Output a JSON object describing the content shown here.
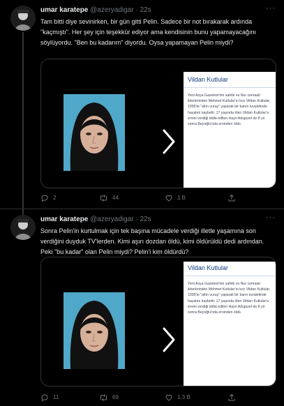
{
  "tweets": [
    {
      "user": {
        "name": "umar karatepe",
        "handle": "@azeryadigar",
        "dot": "·",
        "time": "22s"
      },
      "text": "Tam bitti diye sevinirken, bir gün gitti Pelin. Sadece bir not bırakarak ardında \"kaçmıştı\". Her şey için teşekkür ediyor ama kendisinin bunu yapamayacağını söylüyordu. \"Ben bu kadarım\" diyordu. Oysa yapamayan Pelin miydi?",
      "card": {
        "title": "Vildan Kutlular",
        "text": "Yeni Asya Gazetesi'nin sahibi ve Nur cemaati liderlerinden Mehmet Kutlular'ın kızı Vildan Kutlular, 1995'te \"altın vuruş\" yaparak bir banın tuvaletinde hayatını kaybetti. 17 yaşında ölen Vildan Kutlular'a eroini verdiği iddia edilen Hayri Adıgüzel de 8 yıl sonra Beyoğlu'nda eroinden öldü."
      },
      "actions": {
        "reply": "2",
        "retweet": "44",
        "like": "1 B"
      }
    },
    {
      "user": {
        "name": "umar karatepe",
        "handle": "@azeryadigar",
        "dot": "·",
        "time": "22s"
      },
      "text": "Sonra Pelin'in kurtulmak için tek başına mücadele verdiği illetle yaşamına son verdiğini duyduk TV'lerden. Kimi aşırı dozdan öldü, kimi öldürüldü dedi ardından. Peki \"bu kadar\" olan Pelin miydi? Pelin'i kim öldürdü?",
      "card": {
        "title": "Vildan Kutlular",
        "text": "Yeni Asya Gazetesi'nin sahibi ve Nur cemaati liderlerinden Mehmet Kutlular'ın kızı Vildan Kutlular, 1995'te \"altın vuruş\" yaparak bir barın tuvaletinde hayatını kaybetti. 17 yaşında ölen Vildan Kutlular'a eroini verdiği iddia edilen Hayri Adıgüzel de 8 yıl sonra Beyoğlu'nda eroinden öldü."
      },
      "actions": {
        "reply": "11",
        "retweet": "69",
        "like": "1,3 B"
      }
    }
  ],
  "icons": {
    "reply": "reply-icon",
    "retweet": "retweet-icon",
    "like": "heart-icon",
    "share": "share-icon",
    "next": "chevron-right-icon",
    "more": "more-icon"
  },
  "more_glyph": "···",
  "colors": {
    "background": "#000000",
    "text": "#e7e9ea",
    "muted": "#71767b",
    "card_title": "#0c3b82",
    "photo_bg": "#4fa8c9"
  }
}
